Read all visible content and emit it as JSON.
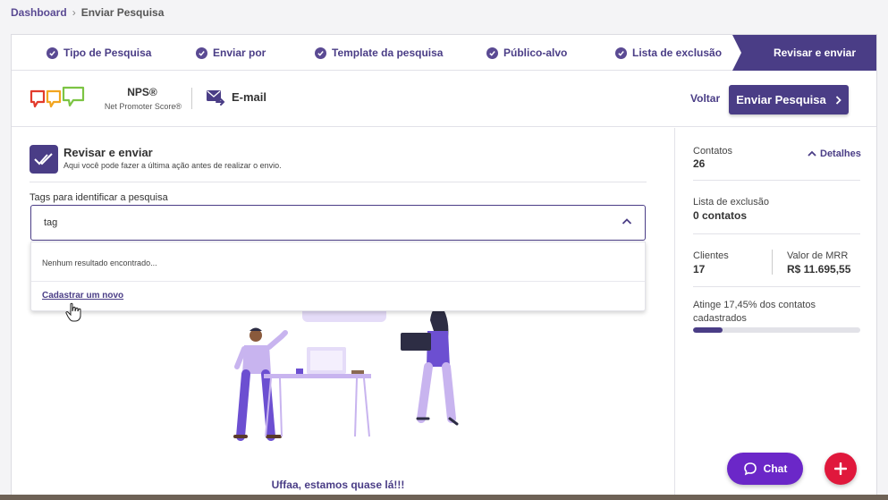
{
  "breadcrumb": {
    "root": "Dashboard",
    "current": "Enviar Pesquisa"
  },
  "steps": [
    {
      "label": "Tipo de Pesquisa"
    },
    {
      "label": "Enviar por"
    },
    {
      "label": "Template da pesquisa"
    },
    {
      "label": "Público-alvo"
    },
    {
      "label": "Lista de exclusão"
    }
  ],
  "active_step": {
    "label": "Revisar e enviar"
  },
  "survey": {
    "type_title": "NPS®",
    "type_subtitle": "Net Promoter Score®",
    "channel": "E-mail"
  },
  "actions": {
    "back_label": "Voltar",
    "send_label": "Enviar Pesquisa"
  },
  "review": {
    "title": "Revisar e enviar",
    "subtitle": "Aqui você pode fazer a última ação antes de realizar o envio."
  },
  "tags": {
    "label": "Tags para identificar a pesquisa",
    "value": "tag",
    "no_results": "Nenhum resultado encontrado...",
    "create_new": "Cadastrar um novo"
  },
  "illustration": {
    "caption": "Uffaa, estamos quase lá!!!"
  },
  "summary": {
    "contacts_label": "Contatos",
    "contacts_value": "26",
    "details_label": "Detalhes",
    "exclusion_label": "Lista de exclusão",
    "exclusion_value": "0 contatos",
    "clients_label": "Clientes",
    "clients_value": "17",
    "mrr_label": "Valor de MRR",
    "mrr_value": "R$ 11.695,55",
    "reach_text": "Atinge 17,45% dos contatos cadastrados",
    "reach_percent": 17.45
  },
  "fab": {
    "chat_label": "Chat"
  },
  "colors": {
    "primary": "#4a3d86",
    "chat": "#6b27c8",
    "add": "#e0183c"
  }
}
